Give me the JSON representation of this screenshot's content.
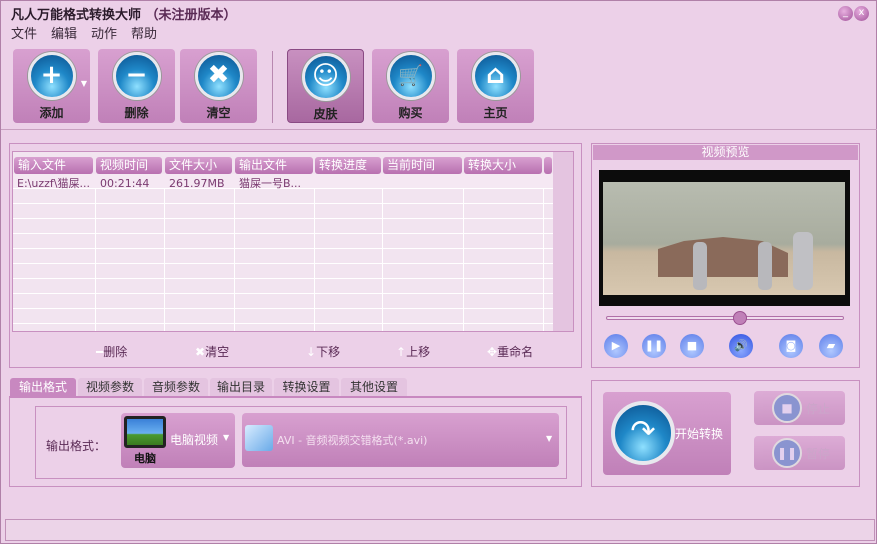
{
  "window": {
    "title": "凡人万能格式转换大师",
    "title_suffix": "（未注册版本）",
    "minimize": "_",
    "close": "x"
  },
  "menu": [
    "文件",
    "编辑",
    "动作",
    "帮助"
  ],
  "toolbar": {
    "add": "添加",
    "delete": "删除",
    "clear": "清空",
    "skin": "皮肤",
    "buy": "购买",
    "home": "主页"
  },
  "table": {
    "headers": [
      "输入文件",
      "视频时间",
      "文件大小",
      "输出文件",
      "转换进度",
      "当前时间",
      "转换大小"
    ],
    "rows": [
      [
        "E:\\uzzf\\猫屎...",
        "00:21:44",
        "261.97MB",
        "猫屎一号B...",
        "",
        "",
        ""
      ]
    ]
  },
  "list_actions": {
    "delete": "删除",
    "clear": "清空",
    "down": "下移",
    "up": "上移",
    "rename": "重命名"
  },
  "preview": {
    "title": "视频预览",
    "progress": 0.56
  },
  "tabs": [
    "输出格式",
    "视频参数",
    "音频参数",
    "输出目录",
    "转换设置",
    "其他设置"
  ],
  "output": {
    "label": "输出格式：",
    "device": "电脑视频",
    "device_icon_label": "电脑",
    "format": "AVI - 音频视频交错格式(*.avi)"
  },
  "convert": {
    "start": "开始转换",
    "stop": "停止",
    "pause": "暂停"
  }
}
